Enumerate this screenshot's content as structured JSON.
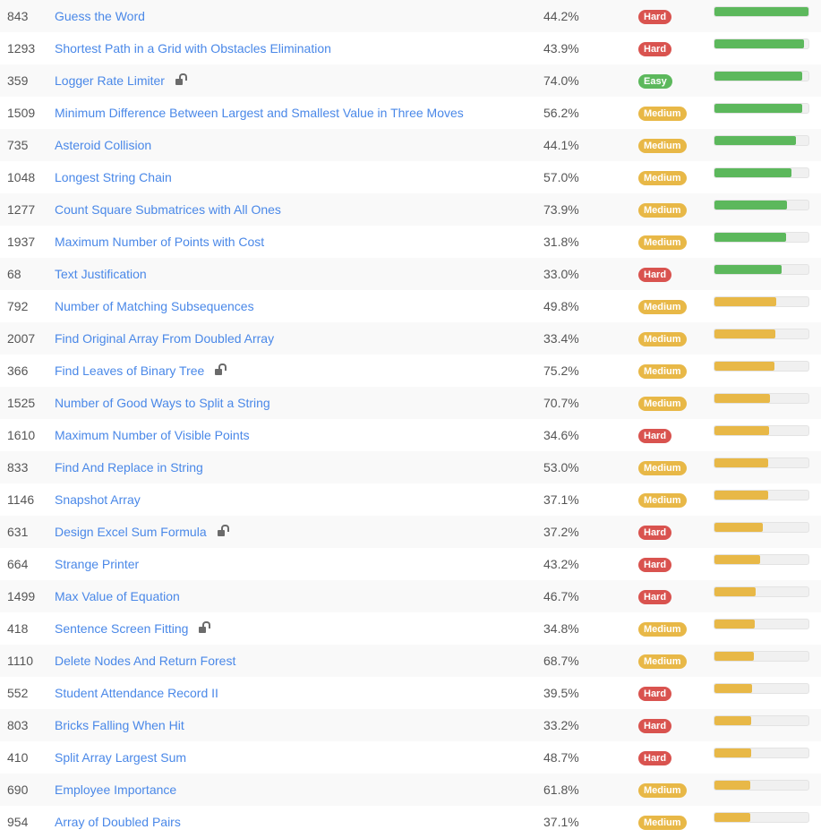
{
  "colors": {
    "link": "#4a88e8",
    "hard": "#d9534f",
    "medium": "#e8b847",
    "easy": "#5cb85c",
    "bar_green": "#5cb85c",
    "bar_yellow": "#e8b847"
  },
  "rows": [
    {
      "id": "843",
      "title": "Guess the Word",
      "locked": false,
      "acceptance": "44.2%",
      "difficulty": "Hard",
      "frequency": 1.0,
      "bar_color": "green"
    },
    {
      "id": "1293",
      "title": "Shortest Path in a Grid with Obstacles Elimination",
      "locked": false,
      "acceptance": "43.9%",
      "difficulty": "Hard",
      "frequency": 0.95,
      "bar_color": "green"
    },
    {
      "id": "359",
      "title": "Logger Rate Limiter",
      "locked": true,
      "acceptance": "74.0%",
      "difficulty": "Easy",
      "frequency": 0.93,
      "bar_color": "green"
    },
    {
      "id": "1509",
      "title": "Minimum Difference Between Largest and Smallest Value in Three Moves",
      "locked": false,
      "acceptance": "56.2%",
      "difficulty": "Medium",
      "frequency": 0.93,
      "bar_color": "green"
    },
    {
      "id": "735",
      "title": "Asteroid Collision",
      "locked": false,
      "acceptance": "44.1%",
      "difficulty": "Medium",
      "frequency": 0.87,
      "bar_color": "green"
    },
    {
      "id": "1048",
      "title": "Longest String Chain",
      "locked": false,
      "acceptance": "57.0%",
      "difficulty": "Medium",
      "frequency": 0.82,
      "bar_color": "green"
    },
    {
      "id": "1277",
      "title": "Count Square Submatrices with All Ones",
      "locked": false,
      "acceptance": "73.9%",
      "difficulty": "Medium",
      "frequency": 0.77,
      "bar_color": "green"
    },
    {
      "id": "1937",
      "title": "Maximum Number of Points with Cost",
      "locked": false,
      "acceptance": "31.8%",
      "difficulty": "Medium",
      "frequency": 0.76,
      "bar_color": "green"
    },
    {
      "id": "68",
      "title": "Text Justification",
      "locked": false,
      "acceptance": "33.0%",
      "difficulty": "Hard",
      "frequency": 0.71,
      "bar_color": "green"
    },
    {
      "id": "792",
      "title": "Number of Matching Subsequences",
      "locked": false,
      "acceptance": "49.8%",
      "difficulty": "Medium",
      "frequency": 0.66,
      "bar_color": "yellow"
    },
    {
      "id": "2007",
      "title": "Find Original Array From Doubled Array",
      "locked": false,
      "acceptance": "33.4%",
      "difficulty": "Medium",
      "frequency": 0.65,
      "bar_color": "yellow"
    },
    {
      "id": "366",
      "title": "Find Leaves of Binary Tree",
      "locked": true,
      "acceptance": "75.2%",
      "difficulty": "Medium",
      "frequency": 0.64,
      "bar_color": "yellow"
    },
    {
      "id": "1525",
      "title": "Number of Good Ways to Split a String",
      "locked": false,
      "acceptance": "70.7%",
      "difficulty": "Medium",
      "frequency": 0.59,
      "bar_color": "yellow"
    },
    {
      "id": "1610",
      "title": "Maximum Number of Visible Points",
      "locked": false,
      "acceptance": "34.6%",
      "difficulty": "Hard",
      "frequency": 0.58,
      "bar_color": "yellow"
    },
    {
      "id": "833",
      "title": "Find And Replace in String",
      "locked": false,
      "acceptance": "53.0%",
      "difficulty": "Medium",
      "frequency": 0.57,
      "bar_color": "yellow"
    },
    {
      "id": "1146",
      "title": "Snapshot Array",
      "locked": false,
      "acceptance": "37.1%",
      "difficulty": "Medium",
      "frequency": 0.57,
      "bar_color": "yellow"
    },
    {
      "id": "631",
      "title": "Design Excel Sum Formula",
      "locked": true,
      "acceptance": "37.2%",
      "difficulty": "Hard",
      "frequency": 0.51,
      "bar_color": "yellow"
    },
    {
      "id": "664",
      "title": "Strange Printer",
      "locked": false,
      "acceptance": "43.2%",
      "difficulty": "Hard",
      "frequency": 0.49,
      "bar_color": "yellow"
    },
    {
      "id": "1499",
      "title": "Max Value of Equation",
      "locked": false,
      "acceptance": "46.7%",
      "difficulty": "Hard",
      "frequency": 0.44,
      "bar_color": "yellow"
    },
    {
      "id": "418",
      "title": "Sentence Screen Fitting",
      "locked": true,
      "acceptance": "34.8%",
      "difficulty": "Medium",
      "frequency": 0.43,
      "bar_color": "yellow"
    },
    {
      "id": "1110",
      "title": "Delete Nodes And Return Forest",
      "locked": false,
      "acceptance": "68.7%",
      "difficulty": "Medium",
      "frequency": 0.42,
      "bar_color": "yellow"
    },
    {
      "id": "552",
      "title": "Student Attendance Record II",
      "locked": false,
      "acceptance": "39.5%",
      "difficulty": "Hard",
      "frequency": 0.4,
      "bar_color": "yellow"
    },
    {
      "id": "803",
      "title": "Bricks Falling When Hit",
      "locked": false,
      "acceptance": "33.2%",
      "difficulty": "Hard",
      "frequency": 0.39,
      "bar_color": "yellow"
    },
    {
      "id": "410",
      "title": "Split Array Largest Sum",
      "locked": false,
      "acceptance": "48.7%",
      "difficulty": "Hard",
      "frequency": 0.39,
      "bar_color": "yellow"
    },
    {
      "id": "690",
      "title": "Employee Importance",
      "locked": false,
      "acceptance": "61.8%",
      "difficulty": "Medium",
      "frequency": 0.38,
      "bar_color": "yellow"
    },
    {
      "id": "954",
      "title": "Array of Doubled Pairs",
      "locked": false,
      "acceptance": "37.1%",
      "difficulty": "Medium",
      "frequency": 0.38,
      "bar_color": "yellow"
    }
  ]
}
